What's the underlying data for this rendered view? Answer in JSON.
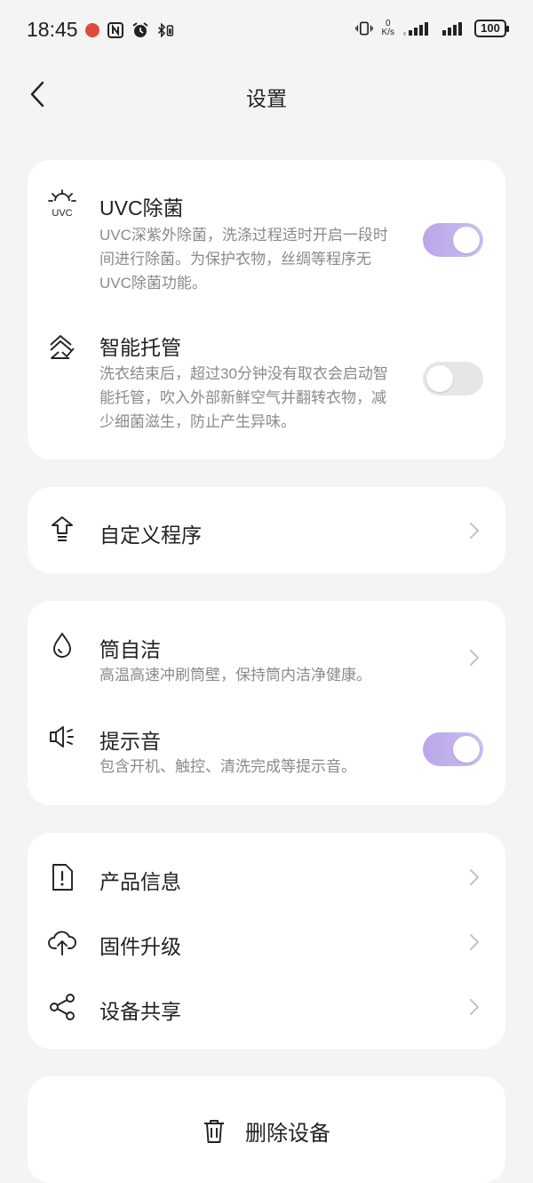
{
  "status": {
    "time": "18:45",
    "speed_value": "0",
    "speed_unit": "K/s",
    "battery": "100"
  },
  "header": {
    "title": "设置"
  },
  "card1": {
    "uvc": {
      "icon": "uvc-sun-icon",
      "icon_text": "UVC",
      "title": "UVC除菌",
      "desc": "UVC深紫外除菌，洗涤过程适时开启一段时间进行除菌。为保护衣物，丝绸等程序无UVC除菌功能。",
      "enabled": true
    },
    "smart": {
      "icon": "smart-hosting-icon",
      "title": "智能托管",
      "desc": "洗衣结束后，超过30分钟没有取衣会启动智能托管，吹入外部新鲜空气并翻转衣物，减少细菌滋生，防止产生异味。",
      "enabled": false
    }
  },
  "card2": {
    "custom": {
      "icon": "custom-program-icon",
      "title": "自定义程序"
    }
  },
  "card3": {
    "drum": {
      "icon": "drop-icon",
      "title": "筒自洁",
      "desc": "高温高速冲刷筒壁，保持筒内洁净健康。"
    },
    "sound": {
      "icon": "speaker-icon",
      "title": "提示音",
      "desc": "包含开机、触控、清洗完成等提示音。",
      "enabled": true
    }
  },
  "card4": {
    "items": [
      {
        "icon": "product-info-icon",
        "title": "产品信息"
      },
      {
        "icon": "cloud-upload-icon",
        "title": "固件升级"
      },
      {
        "icon": "share-icon",
        "title": "设备共享"
      }
    ]
  },
  "delete": {
    "icon": "trash-icon",
    "label": "删除设备"
  },
  "colors": {
    "toggle_on": "#b9a6e8",
    "toggle_off": "#e6e6e6",
    "background": "#f4f4f4",
    "desc_text": "#8a8a8a"
  }
}
